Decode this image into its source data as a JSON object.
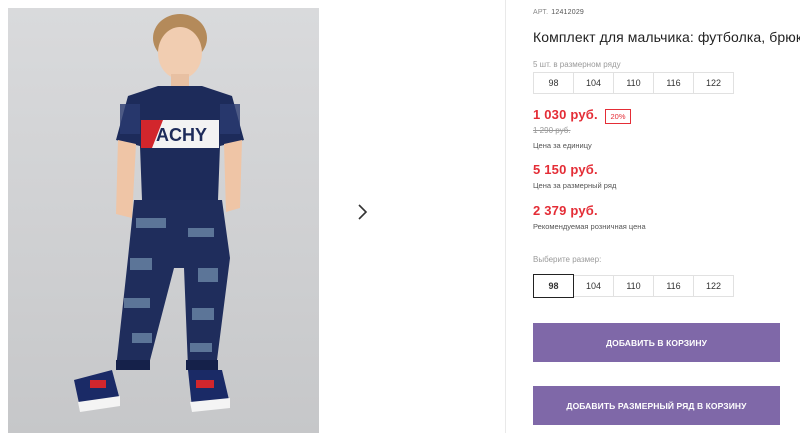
{
  "product": {
    "article_label": "АРТ.",
    "article_number": "12412029",
    "title": "Комплект для мальчика: футболка, брюки"
  },
  "size_row": {
    "hint": "5 шт. в размерном ряду",
    "sizes": [
      "98",
      "104",
      "110",
      "116",
      "122"
    ]
  },
  "prices": {
    "unit_price": "1 030 руб.",
    "discount_badge": "20%",
    "old_price": "1 290 руб.",
    "unit_label": "Цена за единицу",
    "row_price": "5 150 руб.",
    "row_label": "Цена за размерный ряд",
    "retail_price": "2 379 руб.",
    "retail_label": "Рекомендуемая розничная цена"
  },
  "size_select": {
    "hint": "Выберите размер:",
    "sizes": [
      "98",
      "104",
      "110",
      "116",
      "122"
    ],
    "selected": "98"
  },
  "buttons": {
    "add_to_cart": "ДОБАВИТЬ В КОРЗИНУ",
    "add_row_to_cart": "ДОБАВИТЬ РАЗМЕРНЫЙ РЯД В КОРЗИНУ"
  },
  "photo_print": "ACHY",
  "colors": {
    "accent_button": "#7f68a8",
    "price_red": "#e42d36",
    "navy": "#1d2b5a"
  },
  "icons": {
    "gallery_next": "chevron-right-icon"
  }
}
